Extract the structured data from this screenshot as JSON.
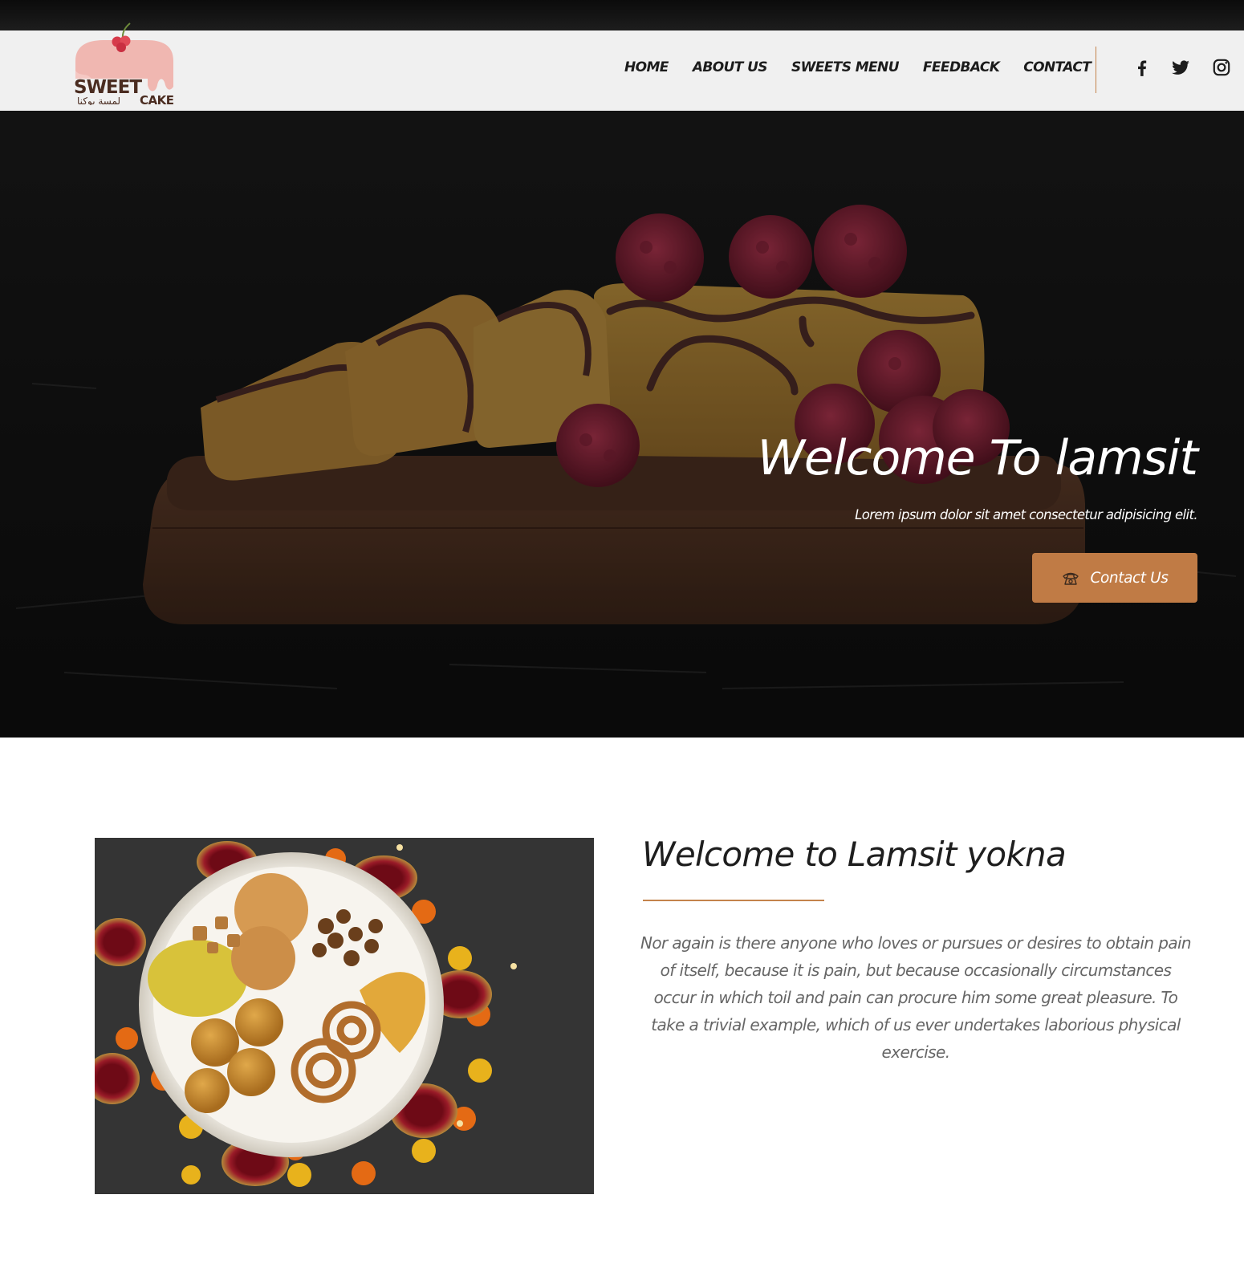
{
  "brand": {
    "logo_word_1": "SWEET",
    "logo_word_2": "CAKE",
    "logo_arabic": "لمسة يوكنا"
  },
  "nav": {
    "items": [
      {
        "label": "HOME"
      },
      {
        "label": "ABOUT US"
      },
      {
        "label": "SWEETS MENU"
      },
      {
        "label": "FEEDBACK"
      },
      {
        "label": "CONTACT"
      }
    ],
    "social": [
      "facebook-icon",
      "twitter-icon",
      "instagram-icon"
    ]
  },
  "hero": {
    "title": "Welcome To lamsit",
    "subtitle": "Lorem ipsum dolor sit amet consectetur adipisicing elit.",
    "button_label": "Contact Us",
    "button_icon": "phone-icon"
  },
  "about": {
    "title": "Welcome to Lamsit yokna",
    "text": "Nor again is there anyone who loves or pursues or desires to obtain pain of itself, because it is pain, but because occasionally circumstances occur in which toil and pain can procure him some great pleasure. To take a trivial example, which of us ever undertakes laborious physical exercise."
  },
  "colors": {
    "accent": "#c07b45",
    "nav_bg": "#f0f0f0",
    "hero_bg": "#161616",
    "text_dark": "#1e1e1e",
    "text_muted": "#666666"
  }
}
